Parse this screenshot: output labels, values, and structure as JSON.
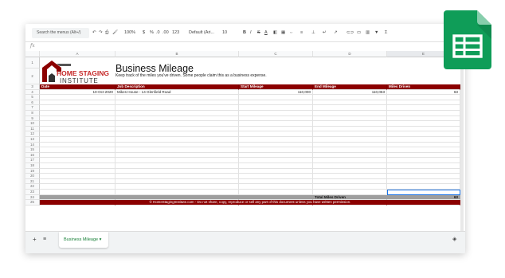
{
  "toolbar": {
    "search_placeholder": "Search the menus (Alt+/)",
    "zoom": "100%",
    "currency": "$",
    "percent": "%",
    "decimal_less": ".0",
    "decimal_more": ".00",
    "number_format": "123",
    "font": "Default (Ari...",
    "font_size": "10"
  },
  "formula_bar": {
    "fx": "fx"
  },
  "columns": [
    "A",
    "B",
    "C",
    "D",
    "E"
  ],
  "row_numbers": [
    "1",
    "2",
    "3",
    "4",
    "5",
    "6",
    "7",
    "8",
    "9",
    "10",
    "11",
    "12",
    "13",
    "14",
    "15",
    "16",
    "17",
    "18",
    "19",
    "20",
    "21",
    "22",
    "23",
    "24",
    "25"
  ],
  "logo": {
    "line1": "HOME STAGING",
    "line2": "INSTITUTE"
  },
  "sheet": {
    "title": "Business Mileage",
    "subtitle": "Keep track of the miles you've driven. Some people claim this as a business expense.",
    "headers": [
      "Date",
      "Job Description",
      "Start Mileage",
      "End Mileage",
      "Miles Driven"
    ],
    "rows": [
      [
        "10-Oct-2020",
        "Mikes House - 14 Glenfield Road",
        "110,000",
        "110,063",
        "63"
      ]
    ],
    "total_label": "Total Miles Driven",
    "total_value": "63",
    "footer": "© HomeStagingInstitute.com - Do not share, copy, reproduce or sell any part of this document unless you have written permission."
  },
  "tabs": {
    "active": "Business Mileage"
  },
  "colors": {
    "brand_red": "#8b0000",
    "total_gray": "#9e9e9e",
    "sheets_green": "#188038"
  }
}
